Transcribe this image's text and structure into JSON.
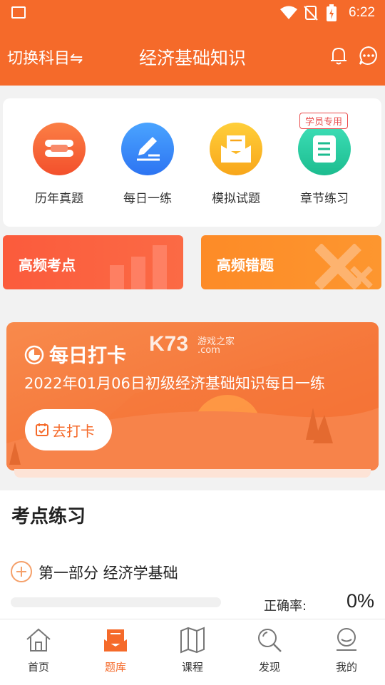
{
  "status_bar": {
    "time": "6:22"
  },
  "header": {
    "switch_label": "切换科目⇋",
    "title": "经济基础知识"
  },
  "grid": {
    "items": [
      {
        "label": "历年真题"
      },
      {
        "label": "每日一练"
      },
      {
        "label": "模拟试题"
      },
      {
        "label": "章节练习",
        "badge": "学员专用"
      }
    ]
  },
  "banners": {
    "left": "高频考点",
    "right": "高频错题"
  },
  "watermark": {
    "brand": "K73",
    "line1": "游戏之家",
    "line2": ".com"
  },
  "checkin": {
    "title": "每日打卡",
    "subtitle": "2022年01月06日初级经济基础知识每日一练",
    "button": "去打卡"
  },
  "practice": {
    "section_title": "考点练习",
    "item_title": "第一部分 经济学基础",
    "accuracy_label": "正确率:",
    "accuracy_value": "0%",
    "progress": 0
  },
  "tabs": [
    {
      "label": "首页"
    },
    {
      "label": "题库",
      "active": true
    },
    {
      "label": "课程"
    },
    {
      "label": "发现"
    },
    {
      "label": "我的"
    }
  ],
  "colors": {
    "brand": "#f56a2a",
    "active_tab": "#f56a2a",
    "banner_left": "#fb5b3c",
    "banner_right": "#fd8b27"
  }
}
